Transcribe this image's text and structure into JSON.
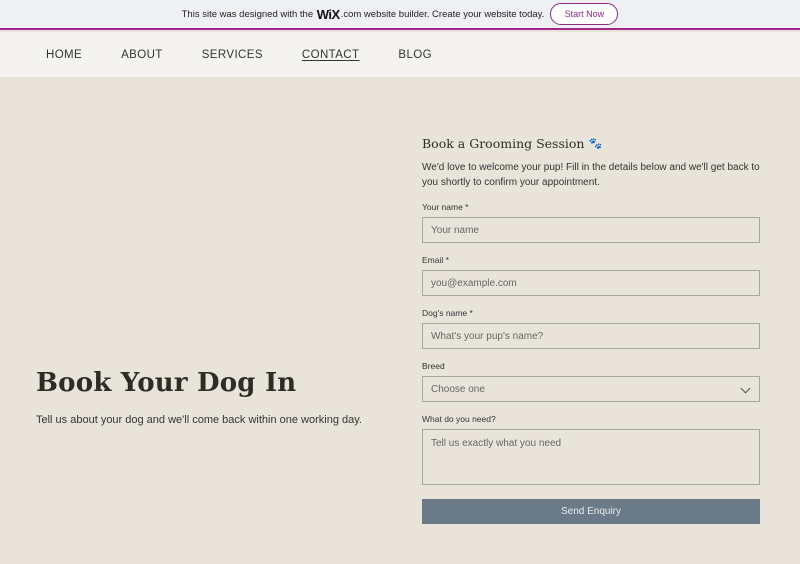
{
  "banner": {
    "prefix": "This site was designed with the",
    "logo": "WiX",
    "suffix": ".com website builder. Create your website today.",
    "cta": "Start Now"
  },
  "nav": {
    "items": [
      "HOME",
      "ABOUT",
      "SERVICES",
      "CONTACT",
      "BLOG"
    ],
    "active": "CONTACT"
  },
  "hero": {
    "title": "Book Your Dog In",
    "subtitle": "Tell us about your dog and we'll come back within one working day."
  },
  "form": {
    "title": "Book a Grooming Session",
    "intro": "We'd love to welcome your pup! Fill in the details below and we'll get back to you shortly to confirm your appointment.",
    "fields": {
      "name": {
        "label": "Your name *",
        "placeholder": "Your name"
      },
      "email": {
        "label": "Email *",
        "placeholder": "you@example.com"
      },
      "dog": {
        "label": "Dog's name *",
        "placeholder": "What's your pup's name?"
      },
      "breed": {
        "label": "Breed",
        "selected": "Choose one"
      },
      "needs": {
        "label": "What do you need?",
        "placeholder": "Tell us exactly what you need"
      }
    },
    "submit": "Send Enquiry"
  },
  "icons": {
    "paw": "paw-icon",
    "chevron": "chevron-down-icon"
  },
  "colors": {
    "background": "#e8e4da",
    "accent": "#a0258c",
    "button": "#6b7a89"
  }
}
